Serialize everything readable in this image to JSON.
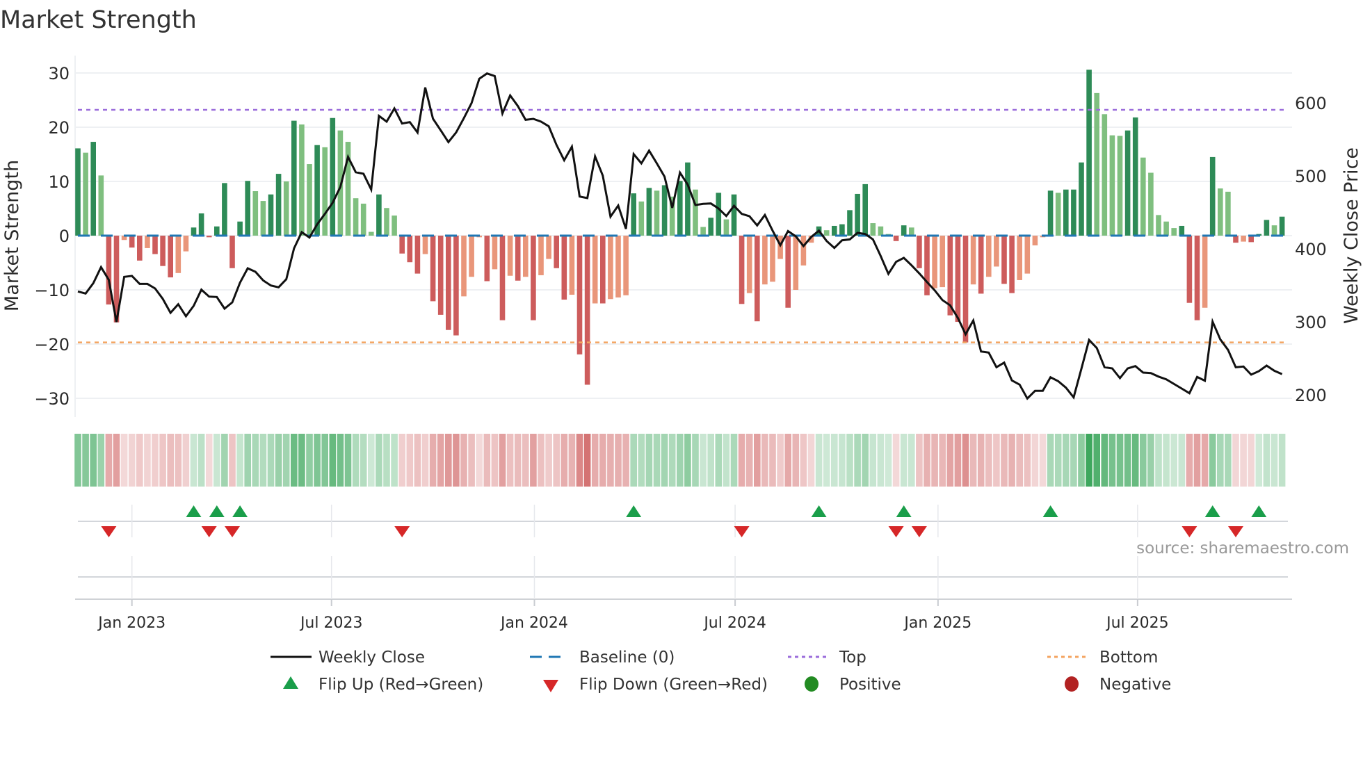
{
  "title": "Market Strength",
  "source": "source: sharemaestro.com",
  "colors": {
    "bar_pos_strong": "#2e8b57",
    "bar_pos_weak": "#7fbf7f",
    "bar_neg_strong": "#cd5c5c",
    "bar_neg_weak": "#e9967a",
    "close_line": "#111111",
    "baseline": "#1f77b4",
    "top": "#9b6ddb",
    "bottom": "#f4a460",
    "flip_up": "#1a9e4a",
    "flip_down": "#d62728",
    "positive": "#228b22",
    "negative": "#b22222",
    "grid": "#eef0f3"
  },
  "chart_data": {
    "type": "bar",
    "title": "Market Strength",
    "ylabel": "Market Strength",
    "y2label": "Weekly Close Price",
    "frequency": "weekly",
    "start_week": "2022-11-13",
    "ylim": [
      -33.5,
      33.2
    ],
    "y2lim": [
      170,
      665
    ],
    "yticks": [
      {
        "value": 30,
        "label": "30"
      },
      {
        "value": 20,
        "label": "20"
      },
      {
        "value": 10,
        "label": "10"
      },
      {
        "value": 0,
        "label": "0"
      },
      {
        "value": -10,
        "label": "−10"
      },
      {
        "value": -20,
        "label": "−20"
      },
      {
        "value": -30,
        "label": "−30"
      }
    ],
    "y2ticks": [
      {
        "value": 600,
        "label": "600"
      },
      {
        "value": 500,
        "label": "500"
      },
      {
        "value": 400,
        "label": "400"
      },
      {
        "value": 300,
        "label": "300"
      },
      {
        "value": 200,
        "label": "200"
      }
    ],
    "xticks": [
      {
        "date": "2023-01-01",
        "label": "Jan 2023"
      },
      {
        "date": "2023-07-01",
        "label": "Jul 2023"
      },
      {
        "date": "2024-01-01",
        "label": "Jan 2024"
      },
      {
        "date": "2024-07-01",
        "label": "Jul 2024"
      },
      {
        "date": "2025-01-01",
        "label": "Jan 2025"
      },
      {
        "date": "2025-07-01",
        "label": "Jul 2025"
      }
    ],
    "top_level": 23.2,
    "bottom_level": -19.7,
    "baseline": 0,
    "strength": [
      16.1,
      15.3,
      17.3,
      11.1,
      -12.7,
      -16.0,
      -0.8,
      -2.2,
      -4.6,
      -2.3,
      -3.4,
      -5.6,
      -7.7,
      -6.9,
      -2.9,
      1.5,
      4.1,
      -0.3,
      1.7,
      9.7,
      -6.0,
      2.6,
      10.1,
      8.2,
      6.4,
      7.6,
      11.4,
      10.0,
      21.2,
      20.5,
      13.2,
      16.7,
      16.3,
      21.7,
      19.4,
      17.3,
      6.9,
      5.9,
      0.7,
      7.6,
      5.1,
      3.7,
      -3.3,
      -4.9,
      -7.0,
      -3.4,
      -12.1,
      -14.6,
      -17.4,
      -18.4,
      -11.2,
      -7.6,
      -0.3,
      -8.4,
      -6.2,
      -15.6,
      -7.4,
      -8.3,
      -7.6,
      -15.6,
      -7.3,
      -4.3,
      -6.0,
      -11.8,
      -10.9,
      -21.9,
      -27.5,
      -12.5,
      -12.5,
      -11.7,
      -11.4,
      -11.0,
      7.8,
      6.3,
      8.8,
      8.3,
      9.3,
      7.2,
      10.1,
      13.5,
      8.5,
      1.6,
      3.3,
      7.9,
      3.0,
      7.6,
      -12.6,
      -10.6,
      -15.8,
      -9.0,
      -8.5,
      -4.3,
      -13.3,
      -10.0,
      -5.5,
      -1.3,
      1.7,
      1.0,
      1.8,
      2.1,
      4.7,
      7.7,
      9.5,
      2.3,
      1.7,
      0.3,
      -1.0,
      1.9,
      1.5,
      -6.0,
      -11.0,
      -9.7,
      -9.5,
      -14.7,
      -15.9,
      -19.7,
      -9.0,
      -10.7,
      -7.6,
      -5.7,
      -8.9,
      -10.6,
      -8.2,
      -7.0,
      -1.8,
      -0.3,
      8.3,
      7.9,
      8.5,
      8.5,
      13.5,
      30.6,
      26.3,
      22.4,
      18.5,
      18.4,
      19.4,
      21.8,
      14.4,
      11.6,
      3.8,
      2.6,
      1.4,
      1.8,
      -12.4,
      -15.6,
      -13.3,
      14.5,
      8.7,
      8.1,
      -1.3,
      -1.1,
      -1.2,
      0.3,
      2.9,
      1.9,
      3.5
    ],
    "close": [
      341.6,
      338.8,
      353,
      375,
      357.5,
      299.7,
      361.6,
      363,
      352,
      352,
      345.7,
      331.4,
      312.4,
      324.1,
      307.6,
      321.9,
      344.1,
      334.6,
      334,
      318.1,
      326.7,
      353.6,
      373.3,
      368.6,
      356.8,
      349.8,
      347.3,
      358.4,
      400.6,
      422.9,
      415.5,
      433.6,
      447.9,
      463.1,
      484.8,
      526,
      505,
      502.9,
      481.2,
      582.2,
      574.3,
      592.4,
      571.7,
      573.7,
      559.4,
      621,
      578.4,
      562.5,
      546.3,
      559.4,
      579,
      599.7,
      633,
      640.3,
      636.8,
      585.4,
      610.2,
      595.6,
      576.8,
      578.1,
      574.3,
      567.9,
      542.5,
      521.3,
      540,
      471.7,
      469.5,
      526.7,
      500.3,
      444.1,
      459.3,
      427.3,
      529.8,
      517.1,
      534.6,
      517.1,
      499,
      456.2,
      504.5,
      488,
      460,
      461.6,
      462.2,
      455.2,
      445,
      459,
      447.9,
      444.8,
      432.1,
      446.4,
      425,
      405,
      424.4,
      417.1,
      403.8,
      416.2,
      425,
      410.8,
      401.2,
      411.7,
      413,
      421.9,
      420.3,
      413,
      390.2,
      365.7,
      382.2,
      387.6,
      377.4,
      366.4,
      354.6,
      343.1,
      329.8,
      322.6,
      305.4,
      282.9,
      301.9,
      259.3,
      257.8,
      237.8,
      244.1,
      219.7,
      214,
      195,
      205.4,
      205.4,
      224.1,
      218.7,
      209.8,
      196.5,
      235.5,
      275.2,
      264.1,
      237.8,
      236.2,
      222.9,
      236.2,
      239.3,
      230.5,
      229.8,
      225,
      221.2,
      214.9,
      208.6,
      202.2,
      224.5,
      219.3,
      300.3,
      275.9,
      261.6,
      237.8,
      238.8,
      227.6,
      232.4,
      240,
      233,
      228.3
    ],
    "legend": {
      "weekly_close": "Weekly Close",
      "baseline": "Baseline (0)",
      "top": "Top",
      "bottom": "Bottom",
      "flip_up": "Flip Up (Red→Green)",
      "flip_down": "Flip Down (Green→Red)",
      "positive": "Positive",
      "negative": "Negative"
    },
    "legend_position": "bottom"
  }
}
